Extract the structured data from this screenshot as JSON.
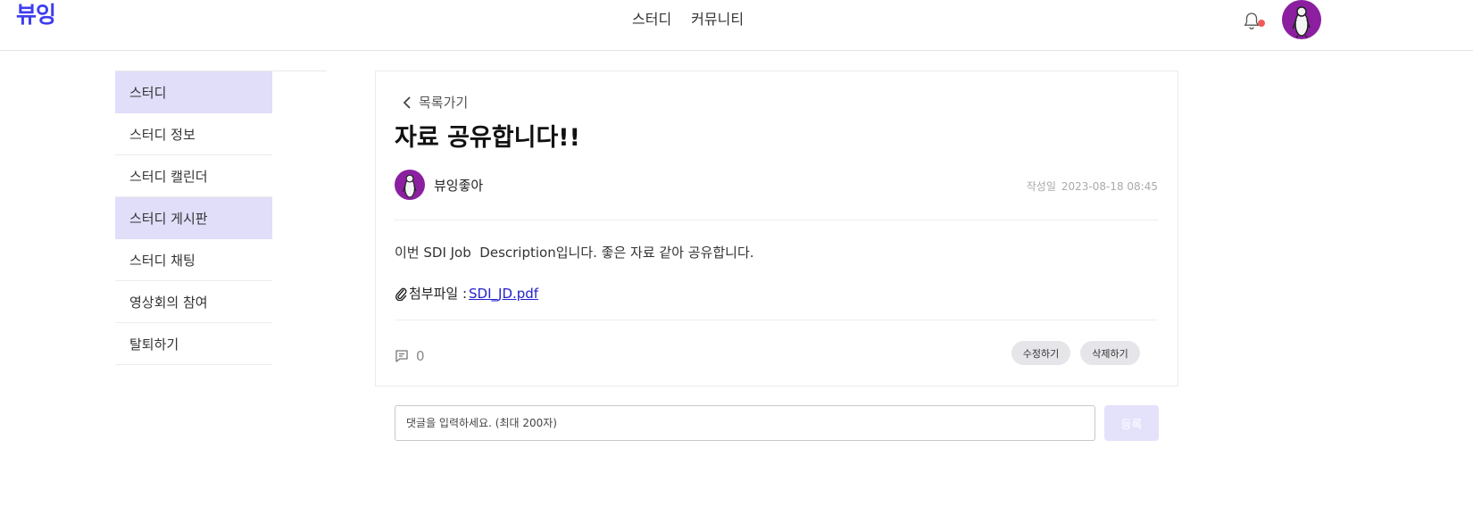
{
  "header": {
    "logo": "뷰잉",
    "nav": [
      "스터디",
      "커뮤니티"
    ],
    "bell_icon": "bell-icon",
    "notification_color": "#f05a5a"
  },
  "sidebar": {
    "items": [
      {
        "label": "스터디",
        "active": true
      },
      {
        "label": "스터디 정보",
        "active": false
      },
      {
        "label": "스터디 캘린더",
        "active": false
      },
      {
        "label": "스터디 게시판",
        "active": true
      },
      {
        "label": "스터디 채팅",
        "active": false
      },
      {
        "label": "영상회의 참여",
        "active": false
      },
      {
        "label": "탈퇴하기",
        "active": false
      }
    ],
    "active_color": "#e1defa"
  },
  "post": {
    "back_label": "목록가기",
    "title": "자료 공유합니다!!",
    "author": "뷰잉좋아",
    "date_label": "작성일",
    "date": "2023-08-18 08:45",
    "body": "이번 SDI Job  Description입니다. 좋은 자료 같아 공유합니다.",
    "attach_label": "첨부파일 : ",
    "attach_file": "SDI_JD.pdf",
    "comment_count": "0",
    "edit_label": "수정하기",
    "delete_label": "삭제하기"
  },
  "comment_box": {
    "placeholder": "댓글을 입력하세요. (최대 200자)",
    "submit_label": "등록"
  },
  "colors": {
    "brand": "#3d3df0",
    "avatar_bg": "#8b1fa0",
    "link": "#2222cc"
  }
}
